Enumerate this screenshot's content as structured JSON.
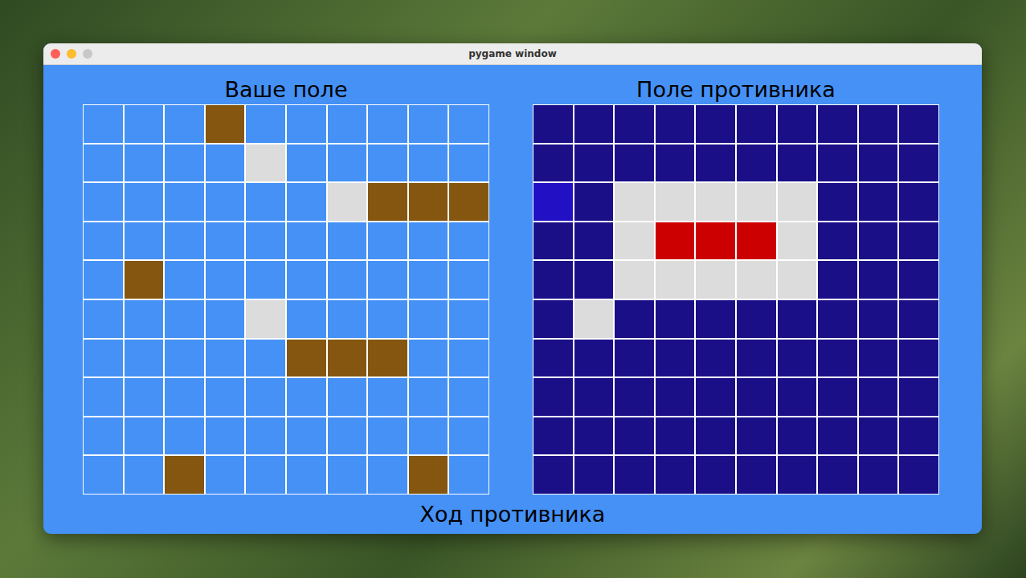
{
  "window": {
    "title": "pygame window"
  },
  "player_field": {
    "title": "Ваше поле",
    "rows": [
      [
        "empty",
        "empty",
        "empty",
        "ship",
        "empty",
        "empty",
        "empty",
        "empty",
        "empty",
        "empty"
      ],
      [
        "empty",
        "empty",
        "empty",
        "empty",
        "miss",
        "empty",
        "empty",
        "empty",
        "empty",
        "empty"
      ],
      [
        "empty",
        "empty",
        "empty",
        "empty",
        "empty",
        "empty",
        "miss",
        "ship",
        "ship",
        "ship"
      ],
      [
        "empty",
        "empty",
        "empty",
        "empty",
        "empty",
        "empty",
        "empty",
        "empty",
        "empty",
        "empty"
      ],
      [
        "empty",
        "ship",
        "empty",
        "empty",
        "empty",
        "empty",
        "empty",
        "empty",
        "empty",
        "empty"
      ],
      [
        "empty",
        "empty",
        "empty",
        "empty",
        "miss",
        "empty",
        "empty",
        "empty",
        "empty",
        "empty"
      ],
      [
        "empty",
        "empty",
        "empty",
        "empty",
        "empty",
        "ship",
        "ship",
        "ship",
        "empty",
        "empty"
      ],
      [
        "empty",
        "empty",
        "empty",
        "empty",
        "empty",
        "empty",
        "empty",
        "empty",
        "empty",
        "empty"
      ],
      [
        "empty",
        "empty",
        "empty",
        "empty",
        "empty",
        "empty",
        "empty",
        "empty",
        "empty",
        "empty"
      ],
      [
        "empty",
        "empty",
        "ship",
        "empty",
        "empty",
        "empty",
        "empty",
        "empty",
        "ship",
        "empty"
      ]
    ]
  },
  "enemy_field": {
    "title": "Поле противника",
    "rows": [
      [
        "empty",
        "empty",
        "empty",
        "empty",
        "empty",
        "empty",
        "empty",
        "empty",
        "empty",
        "empty"
      ],
      [
        "empty",
        "empty",
        "empty",
        "empty",
        "empty",
        "empty",
        "empty",
        "empty",
        "empty",
        "empty"
      ],
      [
        "hover",
        "empty",
        "miss",
        "miss",
        "miss",
        "miss",
        "miss",
        "empty",
        "empty",
        "empty"
      ],
      [
        "empty",
        "empty",
        "miss",
        "hit",
        "hit",
        "hit",
        "miss",
        "empty",
        "empty",
        "empty"
      ],
      [
        "empty",
        "empty",
        "miss",
        "miss",
        "miss",
        "miss",
        "miss",
        "empty",
        "empty",
        "empty"
      ],
      [
        "empty",
        "miss",
        "empty",
        "empty",
        "empty",
        "empty",
        "empty",
        "empty",
        "empty",
        "empty"
      ],
      [
        "empty",
        "empty",
        "empty",
        "empty",
        "empty",
        "empty",
        "empty",
        "empty",
        "empty",
        "empty"
      ],
      [
        "empty",
        "empty",
        "empty",
        "empty",
        "empty",
        "empty",
        "empty",
        "empty",
        "empty",
        "empty"
      ],
      [
        "empty",
        "empty",
        "empty",
        "empty",
        "empty",
        "empty",
        "empty",
        "empty",
        "empty",
        "empty"
      ],
      [
        "empty",
        "empty",
        "empty",
        "empty",
        "empty",
        "empty",
        "empty",
        "empty",
        "empty",
        "empty"
      ]
    ]
  },
  "status": "Ход противника"
}
